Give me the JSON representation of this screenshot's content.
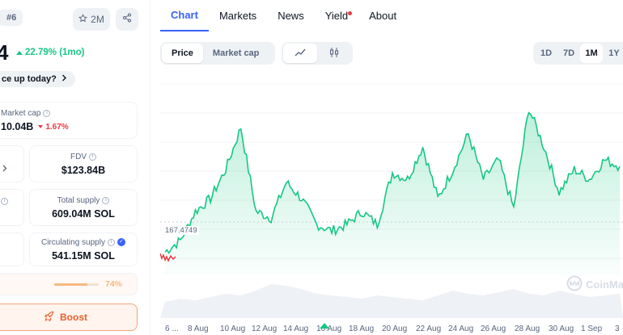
{
  "coin": {
    "rank": "#6",
    "watchlist_count": "2M",
    "price": "4",
    "change": "22.79% (1mo)",
    "question": "ce up today?"
  },
  "stats": {
    "market_cap_label": "Market cap",
    "market_cap_value": "10.04B",
    "market_cap_change": "1.67%",
    "fdv_label": "FDV",
    "fdv_value": "$123.84B",
    "total_supply_label": "Total supply",
    "total_supply_value": "609.04M SOL",
    "circ_supply_label": "Circulating supply",
    "circ_supply_value": "541.15M SOL",
    "circ_percent": "74%",
    "circ_fraction": 0.74
  },
  "boost_label": "Boost",
  "tabs": [
    {
      "label": "Chart",
      "active": true
    },
    {
      "label": "Markets"
    },
    {
      "label": "News"
    },
    {
      "label": "Yield",
      "dot": true
    },
    {
      "label": "About"
    }
  ],
  "chart_controls": {
    "price_label": "Price",
    "marketcap_label": "Market cap",
    "ranges": [
      "1D",
      "7D",
      "1M",
      "1Y"
    ],
    "active_range": "1M"
  },
  "colors": {
    "accent": "#3861fb",
    "up": "#16c784",
    "down": "#ea3943",
    "boost": "#ea5f2a"
  },
  "chart_data": {
    "type": "area",
    "start_price_label": "167.4749",
    "watermark": "CoinMa",
    "x_ticks": [
      "6 ...",
      "8 Aug",
      "10 Aug",
      "12 Aug",
      "14 Aug",
      "16 Aug",
      "18 Aug",
      "20 Aug",
      "22 Aug",
      "24 Aug",
      "26 Aug",
      "28 Aug",
      "30 Aug",
      "1 Sep",
      "3"
    ],
    "x_day_index": [
      0,
      1,
      2,
      3,
      4,
      5,
      6,
      7,
      8,
      9,
      10,
      11,
      12,
      13,
      14,
      15,
      16,
      17,
      18,
      19,
      20,
      21,
      22,
      23,
      24,
      25,
      26,
      27,
      28,
      29,
      30
    ],
    "prices": [
      167.5,
      171,
      180,
      184,
      193,
      206,
      180,
      178,
      189,
      184,
      176,
      174,
      176,
      180,
      176,
      192,
      190,
      200,
      184,
      193,
      204,
      190,
      196,
      181,
      212,
      200,
      186,
      193,
      190,
      196,
      194
    ],
    "volume": [
      20,
      24,
      22,
      26,
      30,
      28,
      34,
      42,
      40,
      36,
      30,
      28,
      26,
      24,
      28,
      26,
      24,
      22,
      28,
      34,
      30,
      28,
      32,
      36,
      30,
      28,
      34,
      30,
      26,
      28,
      30
    ],
    "ylim": [
      160,
      220
    ],
    "grid": true
  }
}
